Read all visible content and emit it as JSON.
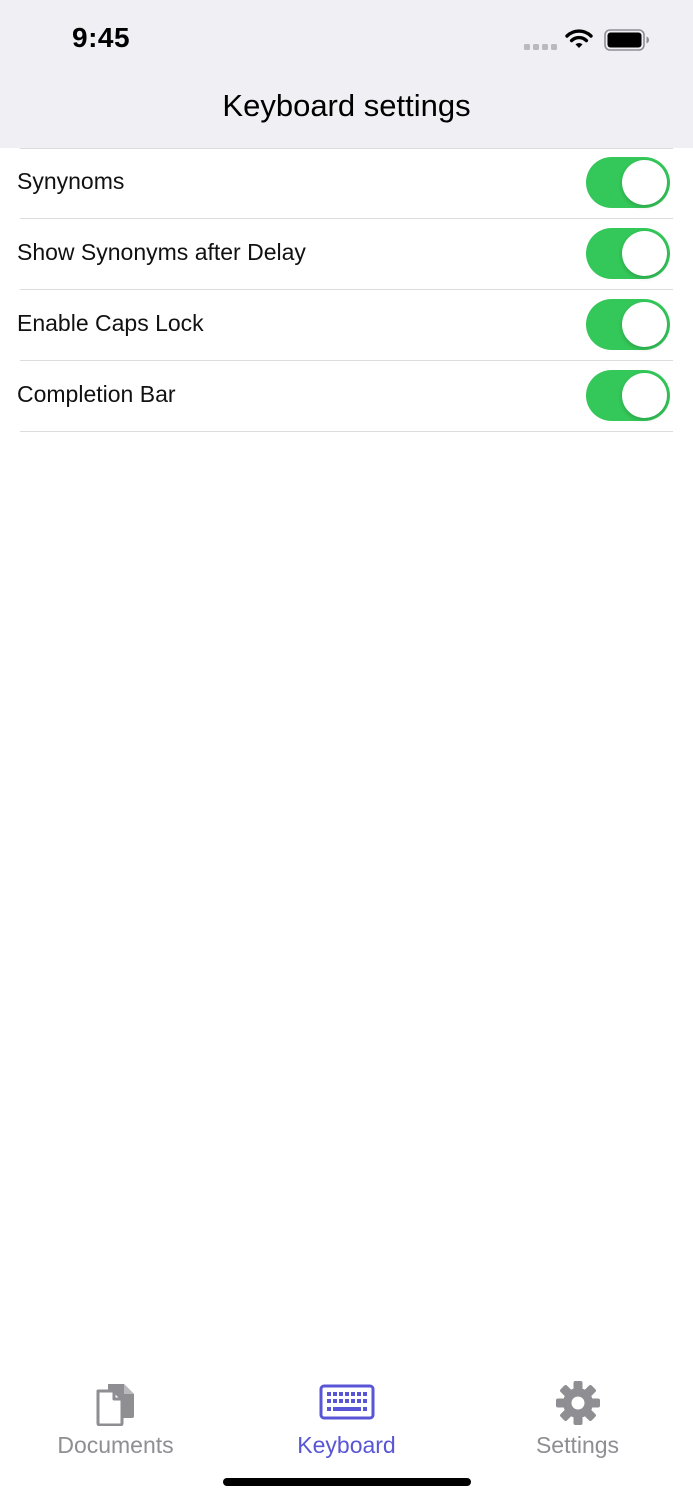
{
  "status_bar": {
    "time": "9:45"
  },
  "nav": {
    "title": "Keyboard settings"
  },
  "settings": [
    {
      "label": "Synynoms",
      "enabled": true
    },
    {
      "label": "Show Synonyms after Delay",
      "enabled": true
    },
    {
      "label": "Enable Caps Lock",
      "enabled": true
    },
    {
      "label": "Completion Bar",
      "enabled": true
    }
  ],
  "tab_bar": {
    "tabs": [
      {
        "label": "Documents",
        "icon": "documents-icon",
        "active": false
      },
      {
        "label": "Keyboard",
        "icon": "keyboard-icon",
        "active": true
      },
      {
        "label": "Settings",
        "icon": "gear-icon",
        "active": false
      }
    ]
  },
  "colors": {
    "toggle_on": "#34c759",
    "accent": "#5856d6",
    "inactive": "#8e8e93",
    "header_bg": "#efeff4"
  }
}
